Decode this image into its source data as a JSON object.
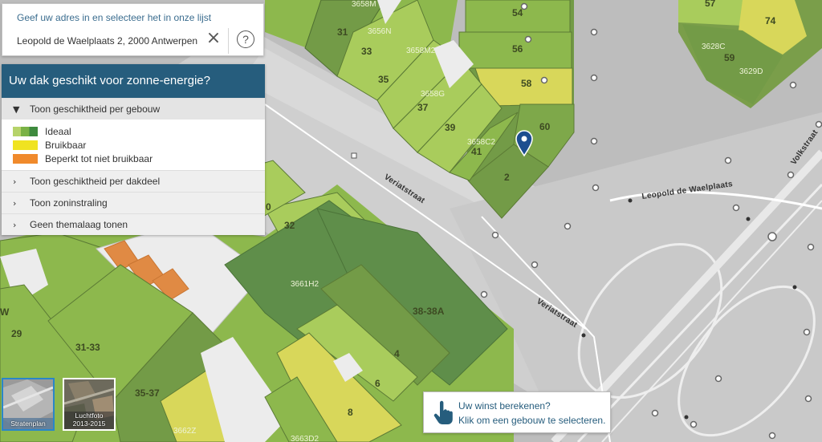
{
  "search": {
    "hint": "Geef uw adres in en selecteer het in onze lijst",
    "value": "Leopold de Waelplaats 2, 2000 Antwerpen",
    "clear_icon": "close-icon",
    "help_label": "?"
  },
  "panel": {
    "title": "Uw dak geschikt voor zonne-energie?",
    "sections": [
      {
        "label": "Toon geschiktheid per gebouw",
        "expanded": true
      },
      {
        "label": "Toon geschiktheid per dakdeel",
        "expanded": false
      },
      {
        "label": "Toon zoninstraling",
        "expanded": false
      },
      {
        "label": "Geen themalaag tonen",
        "expanded": false
      }
    ],
    "legend": [
      {
        "label": "Ideaal",
        "color": "#7ab246"
      },
      {
        "label": "Bruikbaar",
        "color": "#f0e321"
      },
      {
        "label": "Beperkt tot niet bruikbaar",
        "color": "#f08a2c"
      }
    ]
  },
  "basemaps": [
    {
      "label": "Stratenplan",
      "selected": true
    },
    {
      "label_line1": "Luchtfoto",
      "label_line2": "2013-2015",
      "selected": false
    }
  ],
  "winst": {
    "title": "Uw winst berekenen?",
    "subtitle": "Klik om een gebouw te selecteren.",
    "icon": "hand-pointer-icon"
  },
  "map": {
    "streets": [
      "Veriatstraat",
      "Veriatstraat",
      "Leopold de Waelplaats",
      "Volkstraat"
    ],
    "parcel_numbers": [
      "31",
      "33",
      "35",
      "37",
      "39",
      "41",
      "2",
      "60",
      "54",
      "56",
      "58",
      "57",
      "74",
      "59",
      "32",
      "29",
      "31-33",
      "35-37",
      "38-38A",
      "4",
      "6",
      "8",
      "W",
      "0"
    ],
    "parcel_codes": [
      "3658M",
      "3656N",
      "3658M2",
      "3658G",
      "3658C2",
      "3628C",
      "3629D",
      "3661H2",
      "3662Z",
      "3663D2"
    ],
    "marker_icon": "map-pin-icon",
    "colors": {
      "ideal_dark": "#6e9a44",
      "ideal_mid": "#8db84d",
      "ideal_light": "#a9cc5c",
      "bruikbaar": "#d8d75a",
      "beperkt": "#e08a44",
      "road": "#d6d6d6",
      "block": "#b9b9b9",
      "marker": "#1d4e8f"
    }
  }
}
